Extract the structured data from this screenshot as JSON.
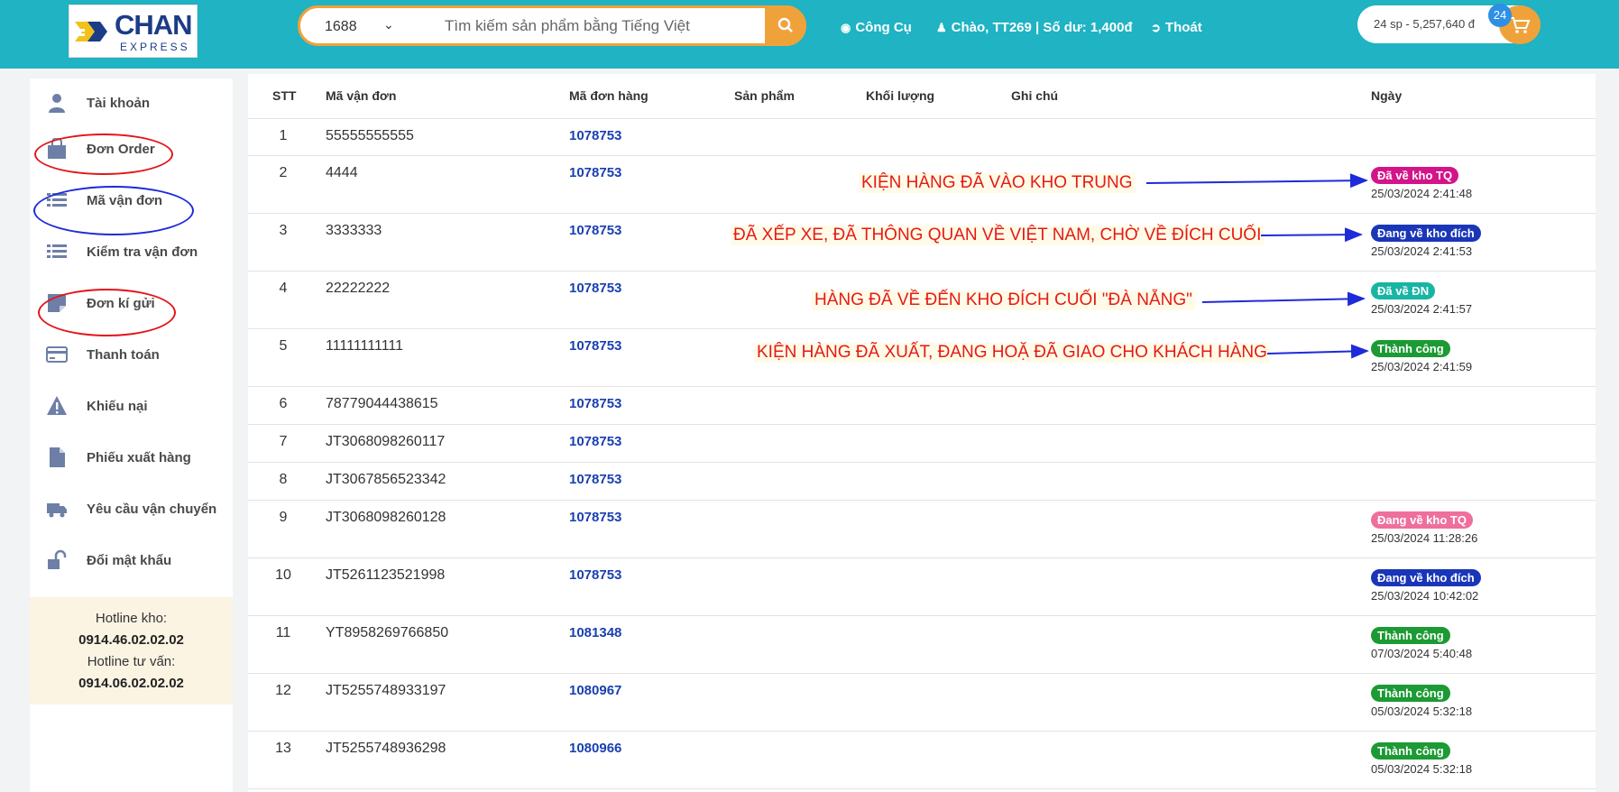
{
  "header": {
    "logo_text": "CHAN",
    "logo_sub": "EXPRESS",
    "search_source": "1688",
    "search_placeholder": "Tìm kiếm sản phẩm bằng Tiếng Việt",
    "nav_tools": "Công Cụ",
    "nav_user": "Chào, TT269 | Số dư: 1,400đ",
    "nav_logout": "Thoát",
    "cart_summary": "24 sp - 5,257,640 đ",
    "cart_count": "24",
    "accent": "#1fb3c3",
    "button_color": "#f0a23a"
  },
  "sidebar": {
    "items": [
      {
        "label": "Tài khoản",
        "icon": "user-icon"
      },
      {
        "label": "Đơn Order",
        "icon": "shopping-bag-icon"
      },
      {
        "label": "Mã vận đơn",
        "icon": "list-icon"
      },
      {
        "label": "Kiểm tra vận đơn",
        "icon": "list-check-icon"
      },
      {
        "label": "Đơn kí gửi",
        "icon": "note-icon"
      },
      {
        "label": "Thanh toán",
        "icon": "credit-card-icon"
      },
      {
        "label": "Khiếu nại",
        "icon": "warning-icon"
      },
      {
        "label": "Phiếu xuất hàng",
        "icon": "file-icon"
      },
      {
        "label": "Yêu cầu vận chuyển",
        "icon": "truck-icon"
      },
      {
        "label": "Đổi mật khẩu",
        "icon": "unlock-icon"
      }
    ],
    "hotline_kho_label": "Hotline kho:",
    "hotline_kho": "0914.46.02.02.02",
    "hotline_tv_label": "Hotline tư vấn:",
    "hotline_tv": "0914.06.02.02.02"
  },
  "table": {
    "headers": {
      "stt": "STT",
      "ma_van_don": "Mã vận đơn",
      "ma_don_hang": "Mã đơn hàng",
      "san_pham": "Sản phẩm",
      "khoi_luong": "Khối lượng",
      "ghi_chu": "Ghi chú",
      "ngay": "Ngày"
    },
    "rows": [
      {
        "stt": "1",
        "mvd": "55555555555",
        "mdh": "1078753",
        "status": "",
        "date": ""
      },
      {
        "stt": "2",
        "mvd": "4444",
        "mdh": "1078753",
        "status": "Đã về kho TQ",
        "date": "25/03/2024 2:41:48"
      },
      {
        "stt": "3",
        "mvd": "3333333",
        "mdh": "1078753",
        "status": "Đang về kho đích",
        "date": "25/03/2024 2:41:53"
      },
      {
        "stt": "4",
        "mvd": "22222222",
        "mdh": "1078753",
        "status": "Đã về ĐN",
        "date": "25/03/2024 2:41:57"
      },
      {
        "stt": "5",
        "mvd": "11111111111",
        "mdh": "1078753",
        "status": "Thành công",
        "date": "25/03/2024 2:41:59"
      },
      {
        "stt": "6",
        "mvd": "78779044438615",
        "mdh": "1078753",
        "status": "",
        "date": ""
      },
      {
        "stt": "7",
        "mvd": "JT3068098260117",
        "mdh": "1078753",
        "status": "",
        "date": ""
      },
      {
        "stt": "8",
        "mvd": "JT3067856523342",
        "mdh": "1078753",
        "status": "",
        "date": ""
      },
      {
        "stt": "9",
        "mvd": "JT3068098260128",
        "mdh": "1078753",
        "status": "Đang về kho TQ",
        "date": "25/03/2024 11:28:26"
      },
      {
        "stt": "10",
        "mvd": "JT5261123521998",
        "mdh": "1078753",
        "status": "Đang về kho đích",
        "date": "25/03/2024 10:42:02"
      },
      {
        "stt": "11",
        "mvd": "YT8958269766850",
        "mdh": "1081348",
        "status": "Thành công",
        "date": "07/03/2024 5:40:48"
      },
      {
        "stt": "12",
        "mvd": "JT5255748933197",
        "mdh": "1080967",
        "status": "Thành công",
        "date": "05/03/2024 5:32:18"
      },
      {
        "stt": "13",
        "mvd": "JT5255748936298",
        "mdh": "1080966",
        "status": "Thành công",
        "date": "05/03/2024 5:32:18"
      }
    ],
    "status_colors": {
      "Đã về kho TQ": "#d4148a",
      "Đang về kho đích": "#1a36b8",
      "Đã về ĐN": "#17b5a3",
      "Thành công": "#1c9a34",
      "Đang về kho TQ": "#ef6f9c"
    }
  },
  "annotations": [
    "KIỆN HÀNG ĐÃ VÀO KHO TRUNG",
    "ĐÃ XẾP XE, ĐÃ THÔNG QUAN VỀ VIỆT NAM, CHỜ VỀ ĐÍCH CUỐI",
    "HÀNG ĐÃ VỀ ĐẾN KHO ĐÍCH CUỐI \"ĐÀ NẴNG\"",
    "KIỆN HÀNG ĐÃ XUẤT, ĐANG HOẶ ĐÃ GIAO CHO KHÁCH HÀNG"
  ]
}
